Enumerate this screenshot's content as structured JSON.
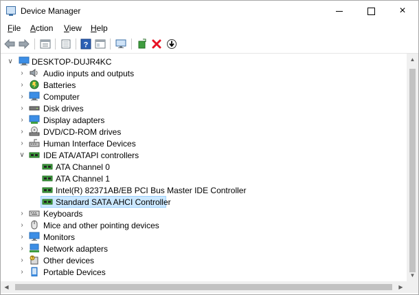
{
  "window": {
    "title": "Device Manager",
    "controls": {
      "minimize": "minimize",
      "maximize": "maximize",
      "close": "×"
    }
  },
  "menu": {
    "items": [
      {
        "first": "F",
        "rest": "ile"
      },
      {
        "first": "A",
        "rest": "ction"
      },
      {
        "first": "V",
        "rest": "iew"
      },
      {
        "first": "H",
        "rest": "elp"
      }
    ]
  },
  "toolbar": {
    "icons": [
      "back-arrow-icon",
      "forward-arrow-icon",
      "properties-icon",
      "update-driver-icon",
      "help-icon",
      "view-icon",
      "scan-hardware-icon",
      "add-legacy-icon",
      "uninstall-icon",
      "disable-device-icon"
    ]
  },
  "tree": {
    "root": "DESKTOP-DUJR4KC",
    "categories": [
      "Audio inputs and outputs",
      "Batteries",
      "Computer",
      "Disk drives",
      "Display adapters",
      "DVD/CD-ROM drives",
      "Human Interface Devices",
      "IDE ATA/ATAPI controllers"
    ],
    "ide_children": [
      "ATA Channel 0",
      "ATA Channel 1",
      "Intel(R) 82371AB/EB PCI Bus Master IDE Controller",
      "Standard SATA AHCI Controller"
    ],
    "categories_after": [
      "Keyboards",
      "Mice and other pointing devices",
      "Monitors",
      "Network adapters",
      "Other devices",
      "Portable Devices"
    ]
  },
  "colors": {
    "selection": "#cce8ff",
    "selection_border": "#99d1ff",
    "uninstall_red": "#e81123",
    "accent": "#0078d7"
  }
}
